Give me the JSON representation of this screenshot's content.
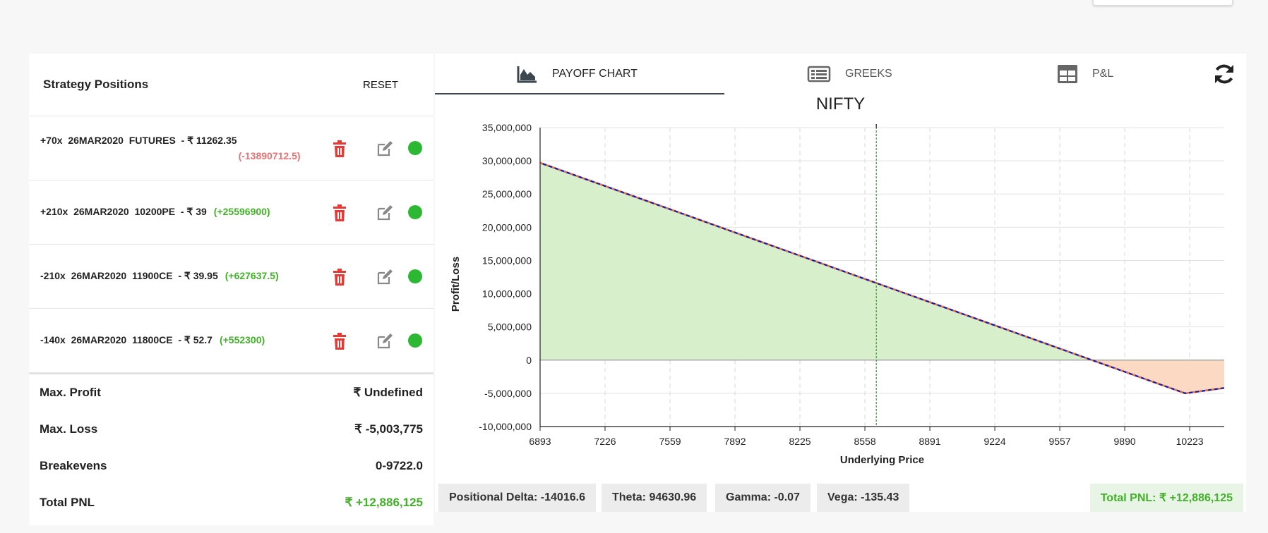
{
  "strategy": {
    "title": "Strategy Positions",
    "reset_label": "RESET",
    "positions": [
      {
        "text": "+70x  26MAR2020  FUTURES  - ₹ 11262.35",
        "pnl": "(-13890712.5)",
        "pnl_color": "#e57373"
      },
      {
        "text": "+210x  26MAR2020  10200PE  - ₹ 39",
        "pnl": "(+25596900)",
        "pnl_color": "#43b02a"
      },
      {
        "text": "-210x  26MAR2020  11900CE  - ₹ 39.95",
        "pnl": "(+627637.5)",
        "pnl_color": "#43b02a"
      },
      {
        "text": "-140x  26MAR2020  11800CE  - ₹ 52.7",
        "pnl": "(+552300)",
        "pnl_color": "#43b02a"
      }
    ]
  },
  "summary": {
    "max_profit_label": "Max. Profit",
    "max_profit_value": "₹ Undefined",
    "max_loss_label": "Max. Loss",
    "max_loss_value": "₹ -5,003,775",
    "breakevens_label": "Breakevens",
    "breakevens_value": "0-9722.0",
    "total_pnl_label": "Total PNL",
    "total_pnl_value": "₹ +12,886,125"
  },
  "tabs": {
    "payoff": "PAYOFF CHART",
    "greeks": "GREEKS",
    "pnl": "P&L"
  },
  "stats": {
    "delta": "Positional Delta: -14016.6",
    "theta": "Theta: 94630.96",
    "gamma": "Gamma: -0.07",
    "vega": "Vega: -135.43",
    "total": "Total PNL: ₹ +12,886,125"
  },
  "colors": {
    "profit_fill": "#d8efcc",
    "loss_fill": "#fbd9c3",
    "line": "#1a1aa6",
    "line_dash": "#e8763a",
    "spot_line": "#2e9e2e"
  },
  "chart_data": {
    "type": "area",
    "title": "NIFTY",
    "xlabel": "Underlying Price",
    "ylabel": "Profit/Loss",
    "x_ticks": [
      6893,
      7226,
      7559,
      7892,
      8225,
      8558,
      8891,
      9224,
      9557,
      9890,
      10223
    ],
    "y_ticks": [
      35000000,
      30000000,
      25000000,
      20000000,
      15000000,
      10000000,
      5000000,
      0,
      -5000000,
      -10000000
    ],
    "y_tick_labels": [
      "35,000,000",
      "30,000,000",
      "25,000,000",
      "20,000,000",
      "15,000,000",
      "10,000,000",
      "5,000,000",
      "0",
      "-5,000,000",
      "-10,000,000"
    ],
    "xlim": [
      6893,
      10400
    ],
    "ylim": [
      -10000000,
      35000000
    ],
    "spot": {
      "label": "8616.5",
      "x": 8616.5
    },
    "series": [
      {
        "x": [
          6893,
          9722,
          10200,
          10400
        ],
        "y": [
          29700000,
          0,
          -5003775,
          -4200000
        ]
      }
    ]
  }
}
